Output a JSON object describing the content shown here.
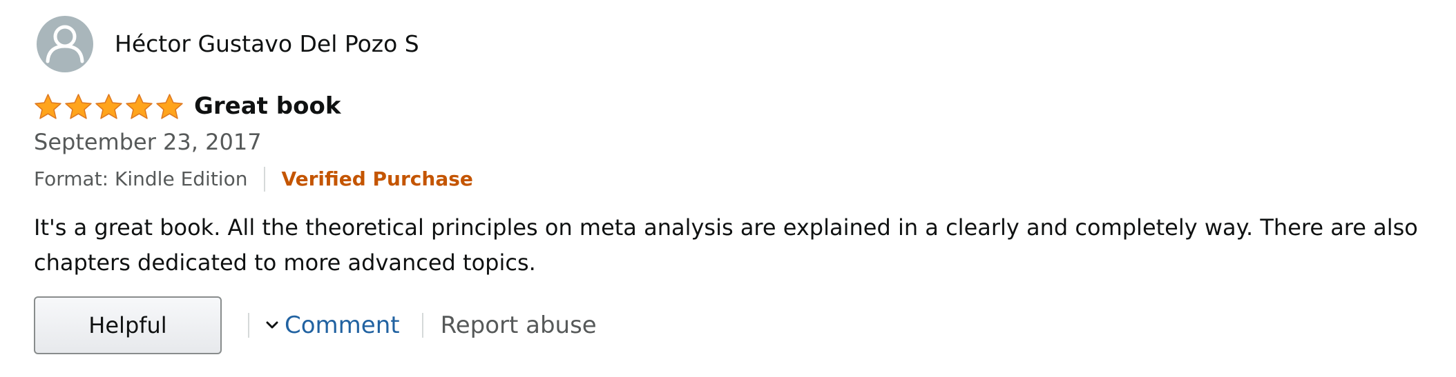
{
  "reviewer": {
    "name": "Héctor Gustavo Del Pozo S",
    "avatar_icon": "person-silhouette-icon",
    "avatar_color": "#a9b6bb"
  },
  "review": {
    "rating": 5,
    "rating_max": 5,
    "star_icon": "star-icon",
    "star_color": "#ffa41c",
    "title": "Great book",
    "date": "September 23, 2017",
    "format": "Format: Kindle Edition",
    "verified": "Verified Purchase",
    "verified_color": "#c45500",
    "body": "It's a great book. All the theoretical principles on meta analysis are explained in a clearly and completely way. There are also chapters dedicated to more advanced topics."
  },
  "actions": {
    "helpful_label": "Helpful",
    "comment_label": "Comment",
    "comment_icon": "chevron-down-icon",
    "report_label": "Report abuse",
    "link_color": "#2162a1"
  }
}
